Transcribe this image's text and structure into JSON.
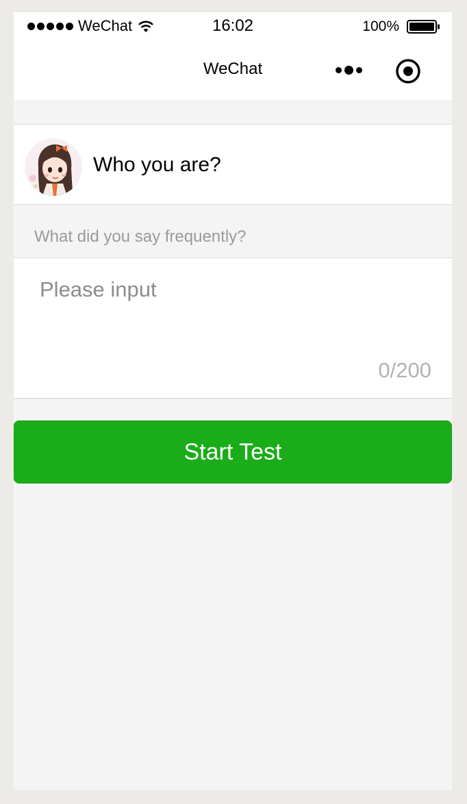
{
  "status_bar": {
    "carrier": "WeChat",
    "time": "16:02",
    "battery": "100%"
  },
  "nav": {
    "title": "WeChat",
    "more_icon": "more-dots-icon",
    "capsule_icon": "target-circle-icon"
  },
  "form": {
    "identity_label": "Who you are?",
    "section_label": "What did you say frequently?",
    "input_placeholder": "Please input",
    "counter": "0/200",
    "submit_label": "Start Test"
  },
  "colors": {
    "accent": "#1aad19",
    "page_background": "#f4f4f4"
  }
}
